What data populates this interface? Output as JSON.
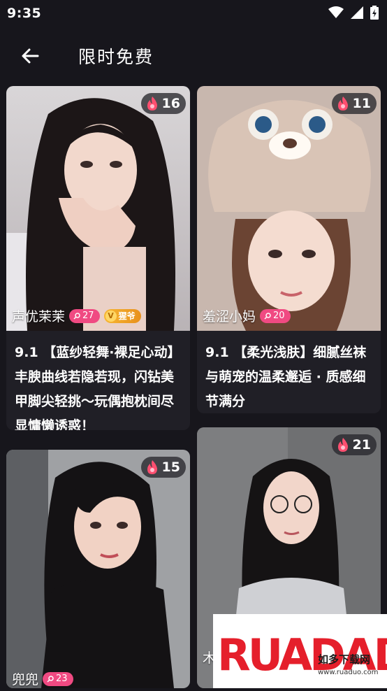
{
  "status_bar": {
    "time": "9:35"
  },
  "header": {
    "title": "限时免费"
  },
  "cards": [
    {
      "heat": "16",
      "name": "声优茉茉",
      "level": "27",
      "vip_label": "猩爷",
      "description": "9.1 【蓝纱轻舞·裸足心动】丰腴曲线若隐若现，闪钻美甲脚尖轻挑～玩偶抱枕间尽显慵懒诱惑！"
    },
    {
      "heat": "11",
      "name": "羞涩小妈",
      "level": "20",
      "description": "9.1 【柔光浅肤】细腻丝袜与萌宠的温柔邂逅 · 质感细节满分"
    },
    {
      "heat": "15",
      "name": "兜兜",
      "level": "23"
    },
    {
      "heat": "21",
      "name": "木"
    }
  ],
  "watermark": {
    "brand": "RUADADO",
    "subtitle": "如多下载网",
    "url": "www.ruaduo.com"
  },
  "colors": {
    "background": "#17161c",
    "level_badge": "#f04a82",
    "heat_fire": "#ff4f70"
  }
}
